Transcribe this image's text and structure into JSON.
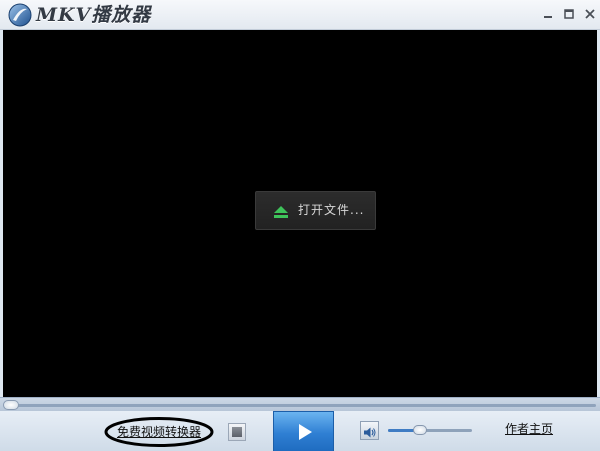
{
  "window": {
    "title": "MKV播放器"
  },
  "video": {
    "open_file_label": "打开文件..."
  },
  "playback": {
    "progress": 0,
    "volume": 0.35
  },
  "controls": {
    "converter_link": "免费视频转换器",
    "author_link": "作者主页"
  },
  "icons": {
    "logo": "app-logo-icon",
    "minimize": "minimize-icon",
    "maximize": "maximize-icon",
    "close": "close-icon",
    "open_file": "eject-icon",
    "stop": "stop-icon",
    "play": "play-icon",
    "volume": "speaker-icon"
  },
  "colors": {
    "video_background": "#000000",
    "open_file_icon": "#3ec35a",
    "play_button": "#2f7fd3",
    "control_bar": "#dbe5ef"
  }
}
